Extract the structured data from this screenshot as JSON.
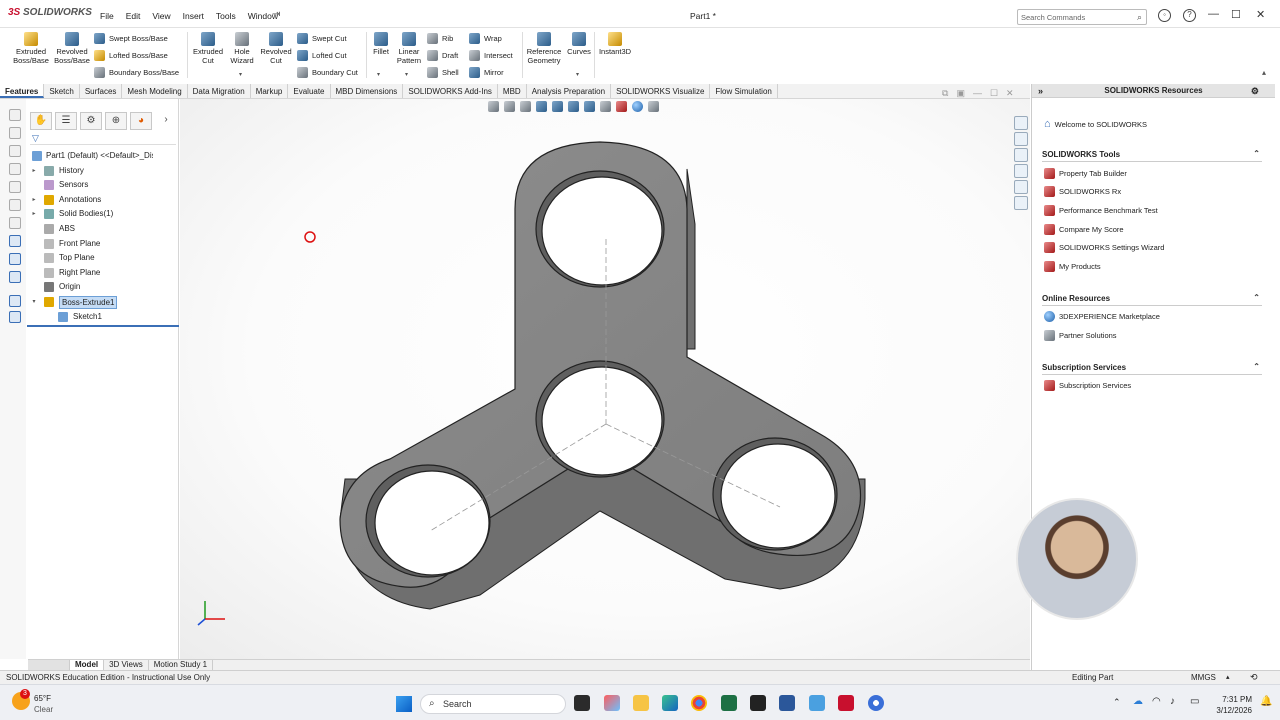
{
  "app": {
    "brand_ds": "3S",
    "brand_name": "SOLIDWORKS",
    "doc_title": "Part1 *"
  },
  "menus": [
    "File",
    "Edit",
    "View",
    "Insert",
    "Tools",
    "Window"
  ],
  "search": {
    "placeholder": "Search Commands"
  },
  "ribbon": {
    "extruded_boss": "Extruded\nBoss/Base",
    "revolved_boss": "Revolved\nBoss/Base",
    "swept_boss": "Swept Boss/Base",
    "lofted_boss": "Lofted Boss/Base",
    "boundary_boss": "Boundary Boss/Base",
    "extruded_cut": "Extruded\nCut",
    "hole_wizard": "Hole\nWizard",
    "revolved_cut": "Revolved\nCut",
    "swept_cut": "Swept Cut",
    "lofted_cut": "Lofted Cut",
    "boundary_cut": "Boundary Cut",
    "fillet": "Fillet",
    "linear_pattern": "Linear\nPattern",
    "rib": "Rib",
    "draft": "Draft",
    "shell": "Shell",
    "wrap": "Wrap",
    "intersect": "Intersect",
    "mirror": "Mirror",
    "reference_geometry": "Reference\nGeometry",
    "curves": "Curves",
    "instant3d": "Instant3D"
  },
  "tabs": [
    "Features",
    "Sketch",
    "Surfaces",
    "Mesh Modeling",
    "Data Migration",
    "Markup",
    "Evaluate",
    "MBD Dimensions",
    "SOLIDWORKS Add-Ins",
    "MBD",
    "Analysis Preparation",
    "SOLIDWORKS Visualize",
    "Flow Simulation"
  ],
  "tree": [
    {
      "label": "Part1 (Default) <<Default>_Displa",
      "expand": ""
    },
    {
      "label": "History",
      "expand": "▸"
    },
    {
      "label": "Sensors",
      "expand": ""
    },
    {
      "label": "Annotations",
      "expand": "▸"
    },
    {
      "label": "Solid Bodies(1)",
      "expand": "▸"
    },
    {
      "label": "ABS",
      "expand": ""
    },
    {
      "label": "Front Plane",
      "expand": ""
    },
    {
      "label": "Top Plane",
      "expand": ""
    },
    {
      "label": "Right Plane",
      "expand": ""
    },
    {
      "label": "Origin",
      "expand": ""
    },
    {
      "label": "Boss-Extrude1",
      "expand": "▾"
    },
    {
      "label": "Sketch1",
      "expand": ""
    }
  ],
  "bottom_tabs": [
    "Model",
    "3D Views",
    "Motion Study 1"
  ],
  "resources": {
    "title": "SOLIDWORKS Resources",
    "welcome": "Welcome to SOLIDWORKS",
    "tools_header": "SOLIDWORKS Tools",
    "tools": [
      "Property Tab Builder",
      "SOLIDWORKS Rx",
      "Performance Benchmark Test",
      "Compare My Score",
      "SOLIDWORKS Settings Wizard",
      "My Products"
    ],
    "online_header": "Online Resources",
    "online": [
      "3DEXPERIENCE Marketplace",
      "Partner Solutions"
    ],
    "subs_header": "Subscription Services",
    "subs": [
      "Subscription Services"
    ]
  },
  "status": {
    "left": "SOLIDWORKS Education Edition - Instructional Use Only",
    "mode": "Editing Part",
    "units": "MMGS"
  },
  "taskbar": {
    "weather_temp": "65°F",
    "weather_desc": "Clear",
    "badge": "3",
    "search": "Search",
    "time": "7:31 PM",
    "date": "3/12/2026"
  },
  "colors": {
    "accent": "#3b6fb6",
    "brand_red": "#c8102e",
    "part_grey": "#8a8a8a"
  }
}
